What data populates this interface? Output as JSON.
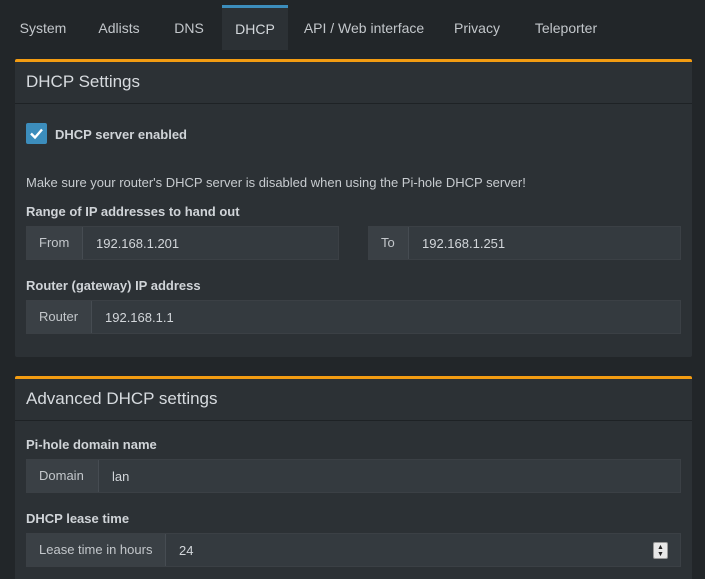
{
  "tabs": [
    "System",
    "Adlists",
    "DNS",
    "DHCP",
    "API / Web interface",
    "Privacy",
    "Teleporter"
  ],
  "dhcp_settings": {
    "title": "DHCP Settings",
    "enabled_label": "DHCP server enabled",
    "enabled": true,
    "warning": "Make sure your router's DHCP server is disabled when using the Pi-hole DHCP server!",
    "range_label": "Range of IP addresses to hand out",
    "from_addon": "From",
    "from_value": "192.168.1.201",
    "to_addon": "To",
    "to_value": "192.168.1.251",
    "router_label": "Router (gateway) IP address",
    "router_addon": "Router",
    "router_value": "192.168.1.1"
  },
  "advanced": {
    "title": "Advanced DHCP settings",
    "domain_label": "Pi-hole domain name",
    "domain_addon": "Domain",
    "domain_value": "lan",
    "lease_label": "DHCP lease time",
    "lease_addon": "Lease time in hours",
    "lease_value": "24"
  },
  "colors": {
    "accent": "#3c8dbc",
    "box_border": "#f39c12",
    "background": "#222629",
    "panel": "#2c3135"
  }
}
